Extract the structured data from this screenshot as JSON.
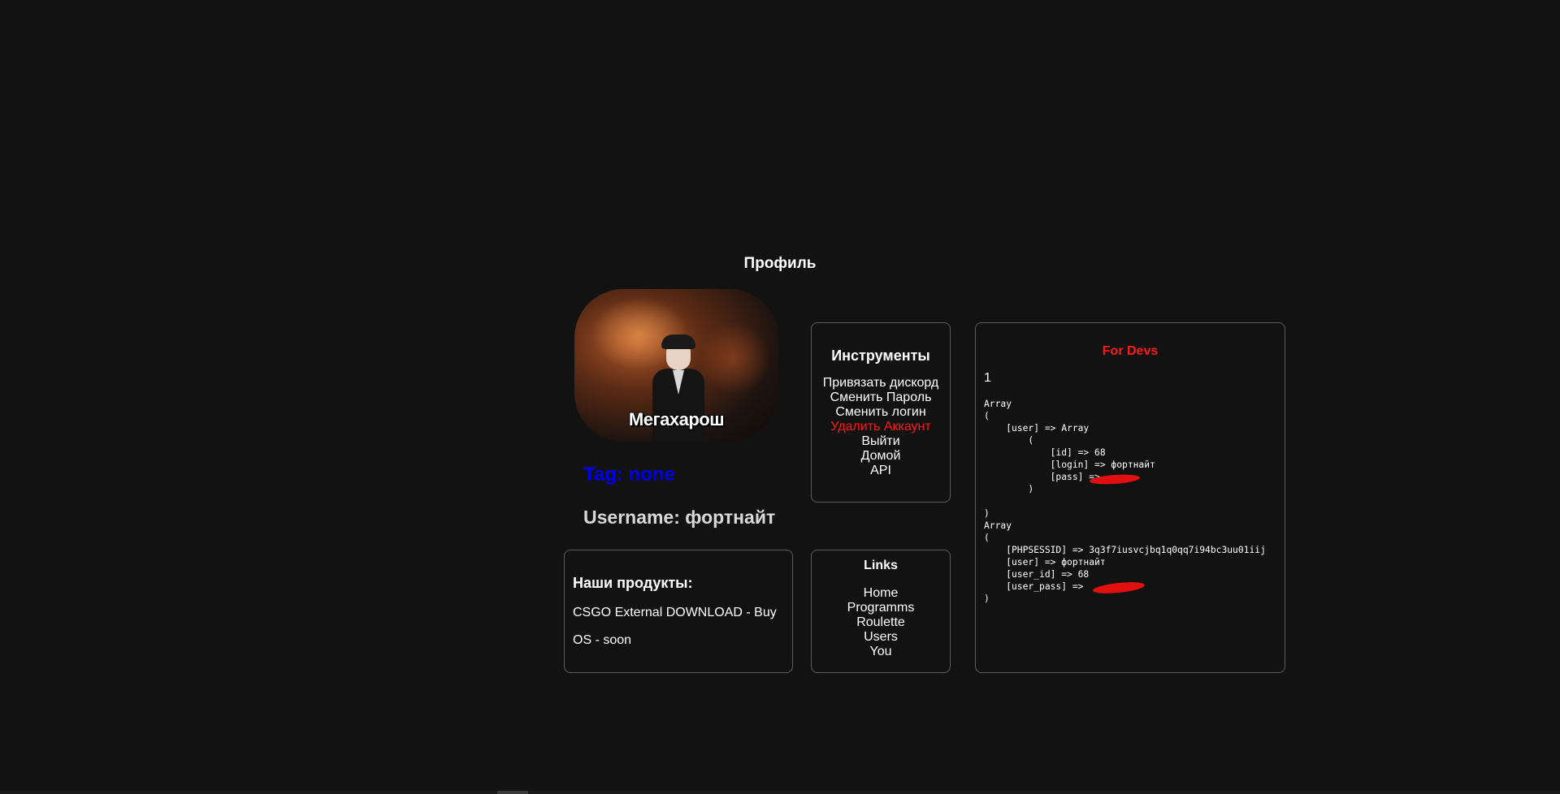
{
  "page": {
    "title": "Профиль"
  },
  "avatar": {
    "caption": "Мегахарош"
  },
  "profile": {
    "tag": "Tag: none",
    "username": "Username: фортнайт"
  },
  "tools": {
    "heading": "Инструменты",
    "items": [
      {
        "label": "Привязать дискорд"
      },
      {
        "label": "Сменить Пароль"
      },
      {
        "label": "Сменить логин"
      },
      {
        "label": "Удалить Аккаунт"
      },
      {
        "label": "Выйти"
      },
      {
        "label": "Домой"
      },
      {
        "label": "API"
      }
    ]
  },
  "devs": {
    "heading": "For Devs",
    "value": "1",
    "dump": "Array\n(\n    [user] => Array\n        (\n            [id] => 68\n            [login] => фортнайт\n            [pass] => \n        )\n\n)\nArray\n(\n    [PHPSESSID] => 3q3f7iusvcjbq1q0qq7i94bc3uu01iij\n    [user] => фортнайт\n    [user_id] => 68\n    [user_pass] => \n)"
  },
  "products": {
    "heading": "Наши продукты:",
    "line1": "CSGO External DOWNLOAD - Buy",
    "line2": "OS - soon"
  },
  "links": {
    "heading": "Links",
    "items": [
      {
        "label": "Home"
      },
      {
        "label": "Programms"
      },
      {
        "label": "Roulette"
      },
      {
        "label": "Users"
      },
      {
        "label": "You"
      }
    ]
  },
  "colors": {
    "background": "#121212",
    "tag": "#0000ee",
    "danger": "#ff1a1a",
    "border": "#5c5c5c"
  }
}
